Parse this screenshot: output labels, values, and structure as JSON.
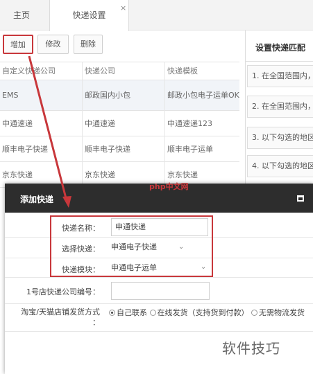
{
  "tabs": [
    {
      "label": "主页"
    },
    {
      "label": "快递设置"
    }
  ],
  "tab_close": "×",
  "toolbar": {
    "add": "增加",
    "edit": "修改",
    "delete": "删除"
  },
  "table": {
    "headers": [
      "自定义快递公司",
      "快递公司",
      "快递模板"
    ],
    "rows": [
      [
        "EMS",
        "邮政国内小包",
        "邮政小包电子运单OK"
      ],
      [
        "中通速递",
        "中通速递",
        "中通速递123"
      ],
      [
        "顺丰电子快递",
        "顺丰电子快递",
        "顺丰电子运单"
      ],
      [
        "京东快递",
        "京东快递",
        "京东快递"
      ]
    ]
  },
  "right_panel": {
    "title": "设置快递匹配",
    "items": [
      "1. 在全国范围内，",
      "2. 在全国范围内，",
      "3. 以下勾选的地区",
      "4. 以下勾选的地区"
    ]
  },
  "dialog": {
    "title": "添加快递",
    "fields": {
      "name_label": "快递名称：",
      "name_value": "申通快递",
      "express_label": "选择快递：",
      "express_value": "申通电子快递",
      "template_label": "快递模块：",
      "template_value": "申通电子运单",
      "code_label": "1号店快递公司编号：",
      "code_value": "",
      "ship_label_1": "淘宝/天猫店铺发货方式",
      "ship_label_2": "：",
      "ship_options": [
        "自己联系",
        "在线发货（支持货到付款）",
        "无需物流发货"
      ],
      "ship_selected": "自己联系"
    }
  },
  "watermarks": {
    "php": "php中文网",
    "brand": "软件技巧"
  },
  "colors": {
    "accent_red": "#c8373b",
    "dialog_header": "#2d2d2d"
  }
}
